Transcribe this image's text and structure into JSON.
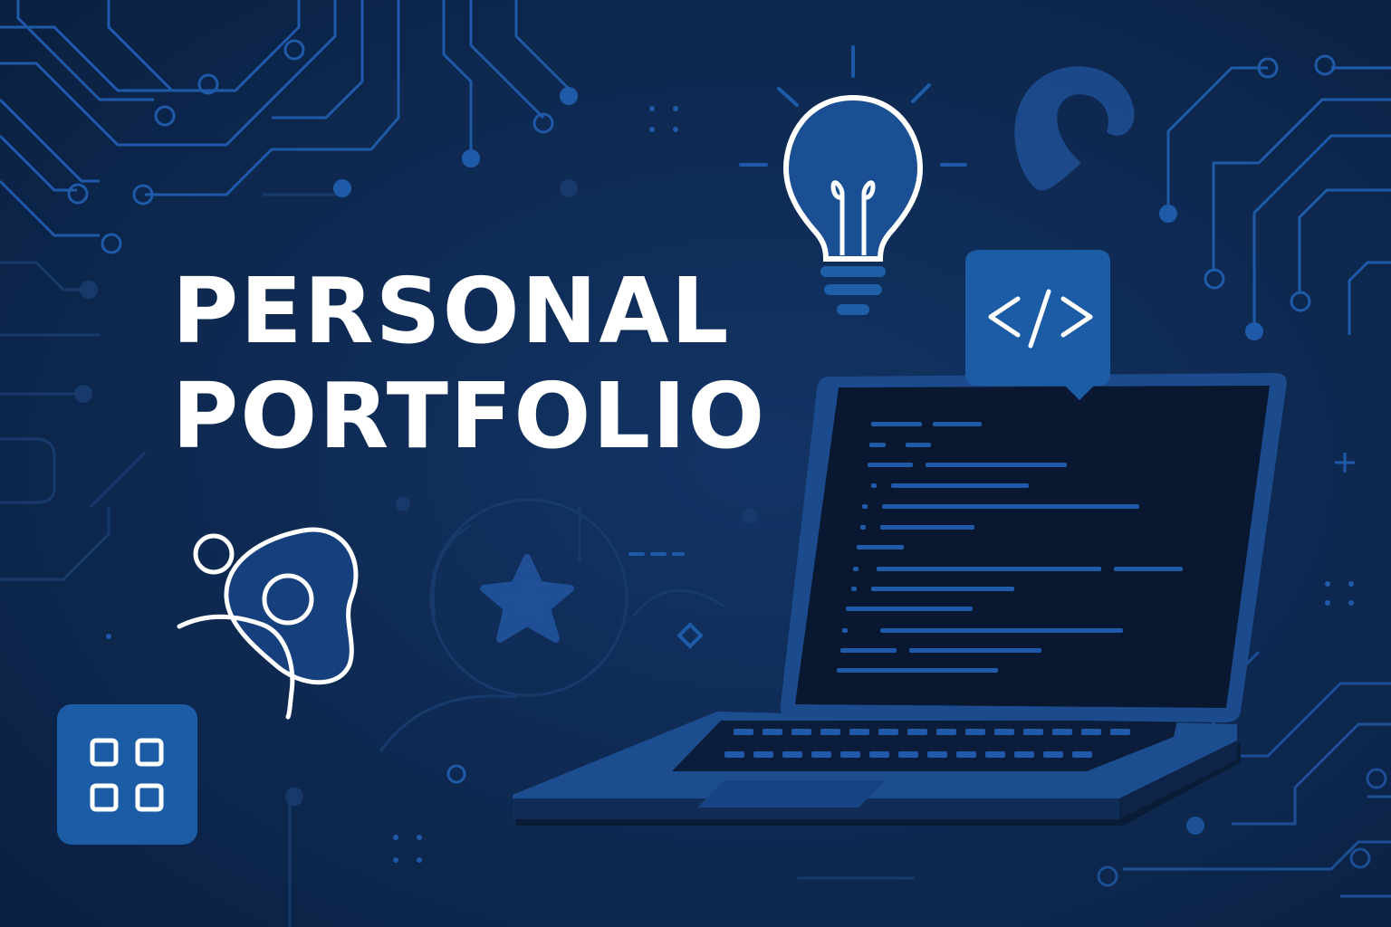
{
  "hero": {
    "title_line1": "PERSONAL",
    "title_line2": "PORTFOLIO"
  },
  "icons": {
    "code_badge": "code-brackets-icon",
    "lightbulb": "lightbulb-icon",
    "grid": "grid-icon",
    "person": "person-icon",
    "star": "star-icon",
    "laptop": "laptop-icon"
  },
  "colors": {
    "background": "#0d2547",
    "circuit": "#1e56a4",
    "accent": "#1f5fa8",
    "text": "#ffffff"
  }
}
